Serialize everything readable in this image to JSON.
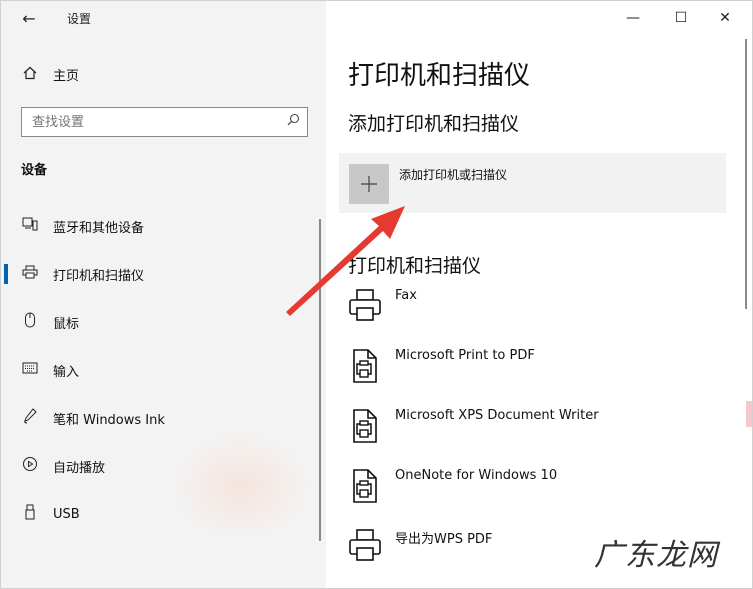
{
  "window": {
    "title": "设置"
  },
  "caption": {
    "minimize": "—",
    "maximize": "☐",
    "close": "✕"
  },
  "sidebar": {
    "home_label": "主页",
    "search_placeholder": "查找设置",
    "section_title": "设备",
    "items": [
      {
        "label": "蓝牙和其他设备",
        "icon": "bluetooth-devices-icon",
        "active": false
      },
      {
        "label": "打印机和扫描仪",
        "icon": "printer-icon",
        "active": true
      },
      {
        "label": "鼠标",
        "icon": "mouse-icon",
        "active": false
      },
      {
        "label": "输入",
        "icon": "keyboard-icon",
        "active": false
      },
      {
        "label": "笔和 Windows Ink",
        "icon": "pen-icon",
        "active": false
      },
      {
        "label": "自动播放",
        "icon": "autoplay-icon",
        "active": false
      },
      {
        "label": "USB",
        "icon": "usb-icon",
        "active": false
      }
    ]
  },
  "main": {
    "title": "打印机和扫描仪",
    "add_section_title": "添加打印机和扫描仪",
    "add_button_label": "添加打印机或扫描仪",
    "list_section_title": "打印机和扫描仪",
    "printers": [
      {
        "name": "Fax"
      },
      {
        "name": "Microsoft Print to PDF"
      },
      {
        "name": "Microsoft XPS Document Writer"
      },
      {
        "name": "OneNote for Windows 10"
      },
      {
        "name": "导出为WPS PDF"
      }
    ]
  },
  "annotation": {
    "arrow_color": "#e53a2f"
  },
  "watermark": {
    "text": "广东龙网"
  },
  "colors": {
    "accent": "#0063b1",
    "sidebar_bg": "#f3f3f3",
    "add_button_bg": "#f2f2f2"
  }
}
